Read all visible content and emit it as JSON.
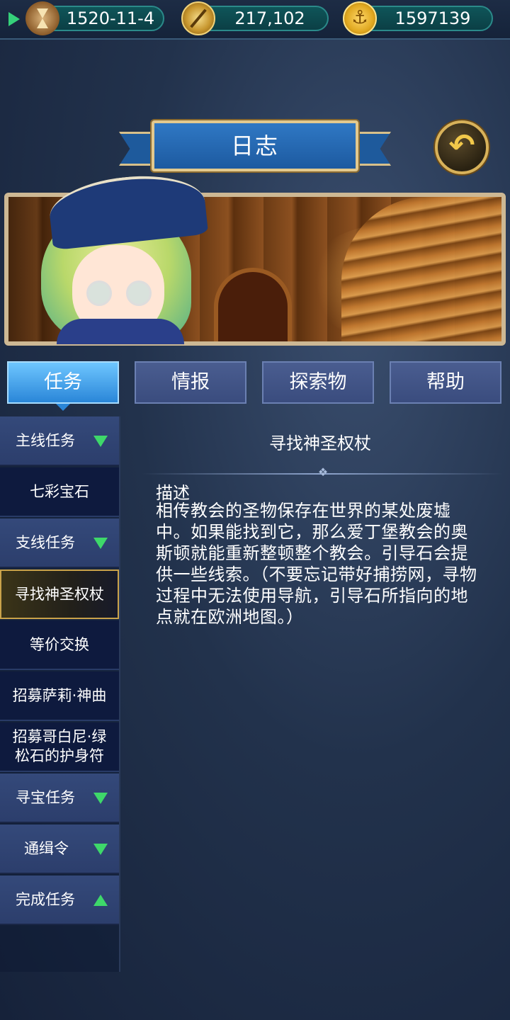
{
  "status_bar": {
    "date": "1520-11-4",
    "reputation": "217,102",
    "gold": "1597139"
  },
  "header": {
    "title": "日志"
  },
  "tabs": [
    {
      "label": "任务",
      "active": true
    },
    {
      "label": "情报",
      "active": false
    },
    {
      "label": "探索物",
      "active": false
    },
    {
      "label": "帮助",
      "active": false
    }
  ],
  "sidebar": {
    "items": [
      {
        "label": "主线任务",
        "type": "group",
        "expanded": true
      },
      {
        "label": "七彩宝石",
        "type": "sub"
      },
      {
        "label": "支线任务",
        "type": "group",
        "expanded": true
      },
      {
        "label": "寻找神圣权杖",
        "type": "sub",
        "selected": true
      },
      {
        "label": "等价交换",
        "type": "sub"
      },
      {
        "label": "招募萨莉·神曲",
        "type": "sub"
      },
      {
        "label": "招募哥白尼·绿松石的护身符",
        "type": "sub"
      },
      {
        "label": "寻宝任务",
        "type": "group",
        "expanded": true
      },
      {
        "label": "通缉令",
        "type": "group",
        "expanded": true
      },
      {
        "label": "完成任务",
        "type": "group",
        "expanded": false
      }
    ]
  },
  "detail": {
    "title": "寻找神圣权杖",
    "description_label": "描述",
    "description": "相传教会的圣物保存在世界的某处废墟中。如果能找到它，那么爱丁堡教会的奥斯顿就能重新整顿整个教会。引导石会提供一些线索。（不要忘记带好捕捞网，寻物过程中无法使用导航，引导石所指向的地点就在欧洲地图。）"
  },
  "colors": {
    "active_tab": "#2a86d8",
    "tab": "#3a4c7e",
    "expand_arrow": "#3ed86a",
    "selected_border": "#c9a24a",
    "status_pill": "#0f5559"
  }
}
